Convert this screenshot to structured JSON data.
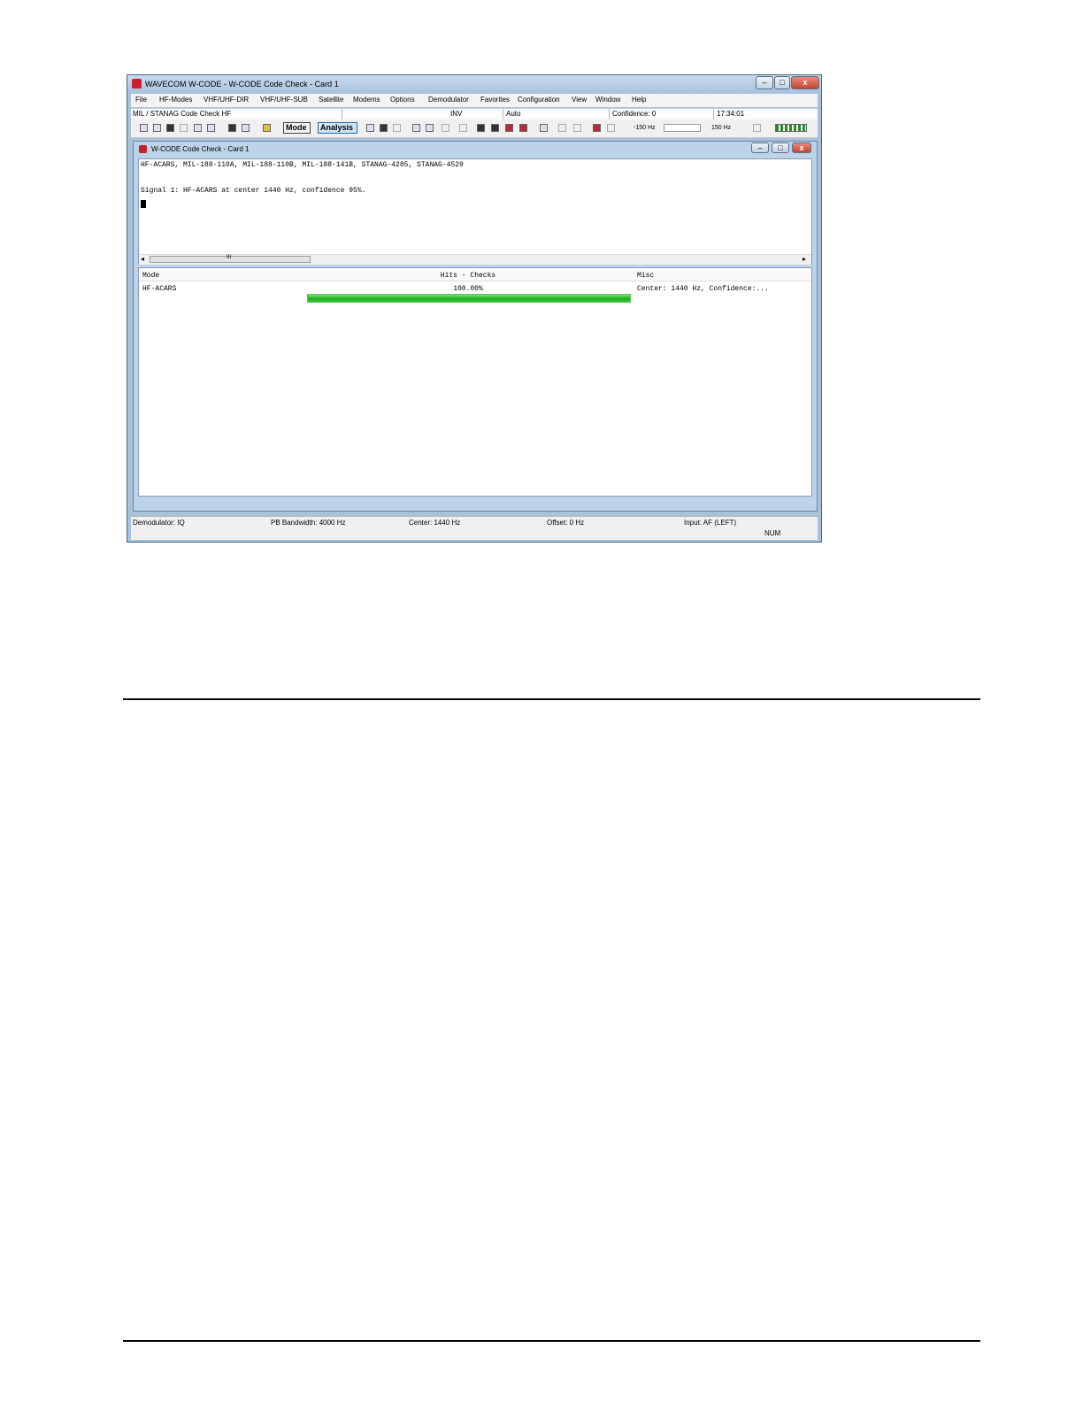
{
  "window": {
    "title": "WAVECOM W-CODE - W-CODE Code Check - Card 1"
  },
  "menu": [
    "File",
    "HF-Modes",
    "VHF/UHF-DIR",
    "VHF/UHF-SUB",
    "Satellite",
    "Modems",
    "Options",
    "Demodulator",
    "Favorites",
    "Configuration",
    "View",
    "Window",
    "Help"
  ],
  "infobar": {
    "mode": "MIL / STANAG Code Check HF",
    "inv": "INV",
    "auto": "Auto",
    "confidence": "Confidence: 0",
    "time": "17:34:01"
  },
  "toolbar": {
    "mode_label": "Mode",
    "analysis_label": "Analysis",
    "freq_low": "-150 Hz",
    "freq_high": "150 Hz"
  },
  "child": {
    "title": "W-CODE Code Check - Card 1",
    "output_lines": [
      "HF-ACARS, MIL-188-110A, MIL-188-110B, MIL-188-141B, STANAG-4285, STANAG-4529",
      "Signal 1: HF-ACARS at center 1440 Hz, confidence 95%."
    ],
    "scroll_grip": "III",
    "list": {
      "columns": [
        "Mode",
        "Hits - Checks",
        "Misc"
      ],
      "rows": [
        {
          "mode": "HF-ACARS",
          "hits": "100.00%",
          "progress": 1.0,
          "misc": "Center: 1440 Hz, Confidence:..."
        }
      ]
    }
  },
  "status": {
    "demodulator": "Demodulator: IQ",
    "bandwidth": "PB Bandwidth: 4000 Hz",
    "center": "Center: 1440 Hz",
    "offset": "Offset: 0 Hz",
    "input": "Input: AF (LEFT)",
    "num": "NUM"
  },
  "colors": {
    "accent": "#1cb51c",
    "frame": "#a9c2dc"
  }
}
